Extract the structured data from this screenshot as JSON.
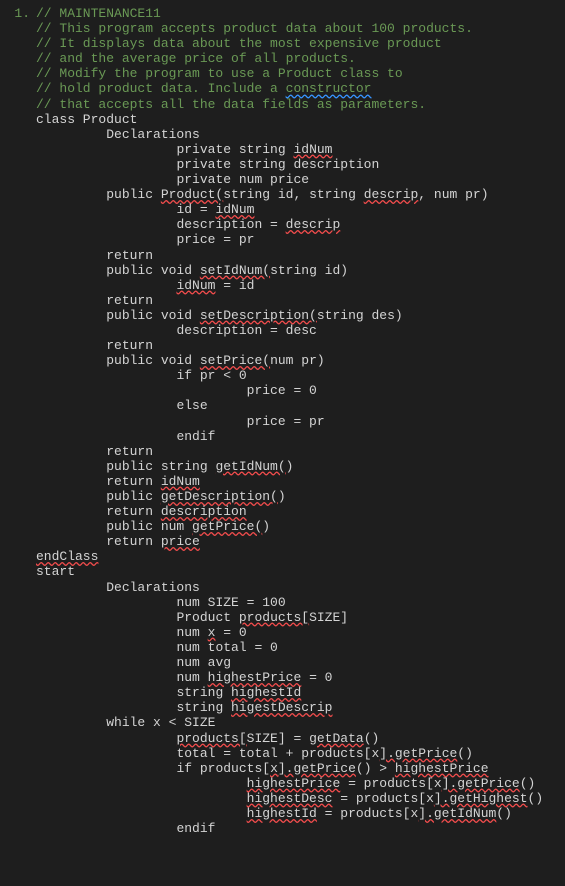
{
  "gutter": "1.",
  "lines": [
    [
      [
        0,
        "c",
        "// MAINTENANCE11"
      ]
    ],
    [
      [
        0,
        "c",
        "// This program accepts product data about 100 products."
      ]
    ],
    [
      [
        0,
        "c",
        "// It displays data about the most expensive product"
      ]
    ],
    [
      [
        0,
        "c",
        "// and the average price of all products."
      ]
    ],
    [
      [
        0,
        "c",
        "// Modify the program to use a Product class to"
      ]
    ],
    [
      [
        0,
        "c",
        "// hold product data. Include a "
      ],
      [
        0,
        "cb",
        "constructor"
      ]
    ],
    [
      [
        0,
        "c",
        "// that accepts all the data fields as parameters."
      ]
    ],
    [
      [
        0,
        "t",
        "class Product"
      ]
    ],
    [
      [
        3,
        "t",
        "Declarations"
      ]
    ],
    [
      [
        6,
        "t",
        "private string "
      ],
      [
        0,
        "sq",
        "idNum"
      ]
    ],
    [
      [
        6,
        "t",
        "private string description"
      ]
    ],
    [
      [
        6,
        "t",
        "private num price"
      ]
    ],
    [
      [
        0,
        "t",
        ""
      ]
    ],
    [
      [
        3,
        "t",
        "public "
      ],
      [
        0,
        "sq",
        "Product("
      ],
      [
        0,
        "t",
        "string id, string "
      ],
      [
        0,
        "sq",
        "descrip"
      ],
      [
        0,
        "t",
        ", num pr)"
      ]
    ],
    [
      [
        6,
        "t",
        "id = "
      ],
      [
        0,
        "sq",
        "idNum"
      ]
    ],
    [
      [
        6,
        "t",
        "description = "
      ],
      [
        0,
        "sq",
        "descrip"
      ]
    ],
    [
      [
        6,
        "t",
        "price = pr"
      ]
    ],
    [
      [
        3,
        "t",
        "return"
      ]
    ],
    [
      [
        3,
        "t",
        "public void "
      ],
      [
        0,
        "sq",
        "setIdNum("
      ],
      [
        0,
        "t",
        "string id)"
      ]
    ],
    [
      [
        6,
        "sq",
        "idNum"
      ],
      [
        0,
        "t",
        " = id"
      ]
    ],
    [
      [
        3,
        "t",
        "return"
      ]
    ],
    [
      [
        3,
        "t",
        "public void "
      ],
      [
        0,
        "sq",
        "setDescription("
      ],
      [
        0,
        "t",
        "string des)"
      ]
    ],
    [
      [
        6,
        "t",
        "description = desc"
      ]
    ],
    [
      [
        3,
        "t",
        "return"
      ]
    ],
    [
      [
        3,
        "t",
        "public void "
      ],
      [
        0,
        "sq",
        "setPrice("
      ],
      [
        0,
        "t",
        "num pr)"
      ]
    ],
    [
      [
        6,
        "t",
        "if pr < 0"
      ]
    ],
    [
      [
        9,
        "t",
        "price = 0"
      ]
    ],
    [
      [
        6,
        "t",
        "else"
      ]
    ],
    [
      [
        9,
        "t",
        "price = pr"
      ]
    ],
    [
      [
        6,
        "t",
        "endif"
      ]
    ],
    [
      [
        3,
        "t",
        "return"
      ]
    ],
    [
      [
        3,
        "t",
        "public string "
      ],
      [
        0,
        "sq",
        "getIdNum("
      ],
      [
        0,
        "t",
        ")"
      ]
    ],
    [
      [
        3,
        "t",
        "return "
      ],
      [
        0,
        "sq",
        "idNum"
      ]
    ],
    [
      [
        3,
        "t",
        "public "
      ],
      [
        0,
        "sq",
        "getDescription("
      ],
      [
        0,
        "t",
        ")"
      ]
    ],
    [
      [
        3,
        "t",
        "return "
      ],
      [
        0,
        "sq",
        "description"
      ]
    ],
    [
      [
        3,
        "t",
        "public num "
      ],
      [
        0,
        "sq",
        "getPrice("
      ],
      [
        0,
        "t",
        ")"
      ]
    ],
    [
      [
        3,
        "t",
        "return "
      ],
      [
        0,
        "sq",
        "price"
      ]
    ],
    [
      [
        0,
        "sq",
        "endClass"
      ]
    ],
    [
      [
        0,
        "t",
        ""
      ]
    ],
    [
      [
        0,
        "t",
        "start"
      ]
    ],
    [
      [
        3,
        "t",
        "Declarations"
      ]
    ],
    [
      [
        6,
        "t",
        "num SIZE = 100"
      ]
    ],
    [
      [
        6,
        "t",
        "Product "
      ],
      [
        0,
        "sq",
        "products["
      ],
      [
        0,
        "t",
        "SIZE]"
      ]
    ],
    [
      [
        6,
        "t",
        "num "
      ],
      [
        0,
        "sq",
        "x"
      ],
      [
        0,
        "t",
        " = 0"
      ]
    ],
    [
      [
        6,
        "t",
        "num total = 0"
      ]
    ],
    [
      [
        6,
        "t",
        "num avg"
      ]
    ],
    [
      [
        6,
        "t",
        "num "
      ],
      [
        0,
        "sq",
        "highestPrice"
      ],
      [
        0,
        "t",
        " = 0"
      ]
    ],
    [
      [
        6,
        "t",
        "string "
      ],
      [
        0,
        "sq",
        "highestId"
      ]
    ],
    [
      [
        6,
        "t",
        "string "
      ],
      [
        0,
        "sq",
        "higestDescrip"
      ]
    ],
    [
      [
        3,
        "t",
        "while x < SIZE"
      ]
    ],
    [
      [
        6,
        "sq",
        "products["
      ],
      [
        0,
        "t",
        "SIZE] = "
      ],
      [
        0,
        "sq",
        "getData"
      ],
      [
        0,
        "t",
        "()"
      ]
    ],
    [
      [
        6,
        "t",
        "total = total + products[x"
      ],
      [
        0,
        "sq",
        "].getPrice"
      ],
      [
        0,
        "t",
        "()"
      ]
    ],
    [
      [
        6,
        "t",
        "if products["
      ],
      [
        0,
        "sq",
        "x"
      ],
      [
        0,
        "sq",
        "].getPrice"
      ],
      [
        0,
        "t",
        "() > "
      ],
      [
        0,
        "sq",
        "highestPrice"
      ]
    ],
    [
      [
        9,
        "sq",
        "highestPrice"
      ],
      [
        0,
        "t",
        " = products[x"
      ],
      [
        0,
        "sq",
        "].getPrice"
      ],
      [
        0,
        "t",
        "()"
      ]
    ],
    [
      [
        9,
        "sq",
        "highestDesc"
      ],
      [
        0,
        "t",
        " = products[x"
      ],
      [
        0,
        "sq",
        "].getHighest"
      ],
      [
        0,
        "t",
        "()"
      ]
    ],
    [
      [
        9,
        "sq",
        "highestId"
      ],
      [
        0,
        "t",
        " = products[x"
      ],
      [
        0,
        "sq",
        "].getIdNum"
      ],
      [
        0,
        "t",
        "()"
      ]
    ],
    [
      [
        6,
        "t",
        "endif"
      ]
    ]
  ]
}
